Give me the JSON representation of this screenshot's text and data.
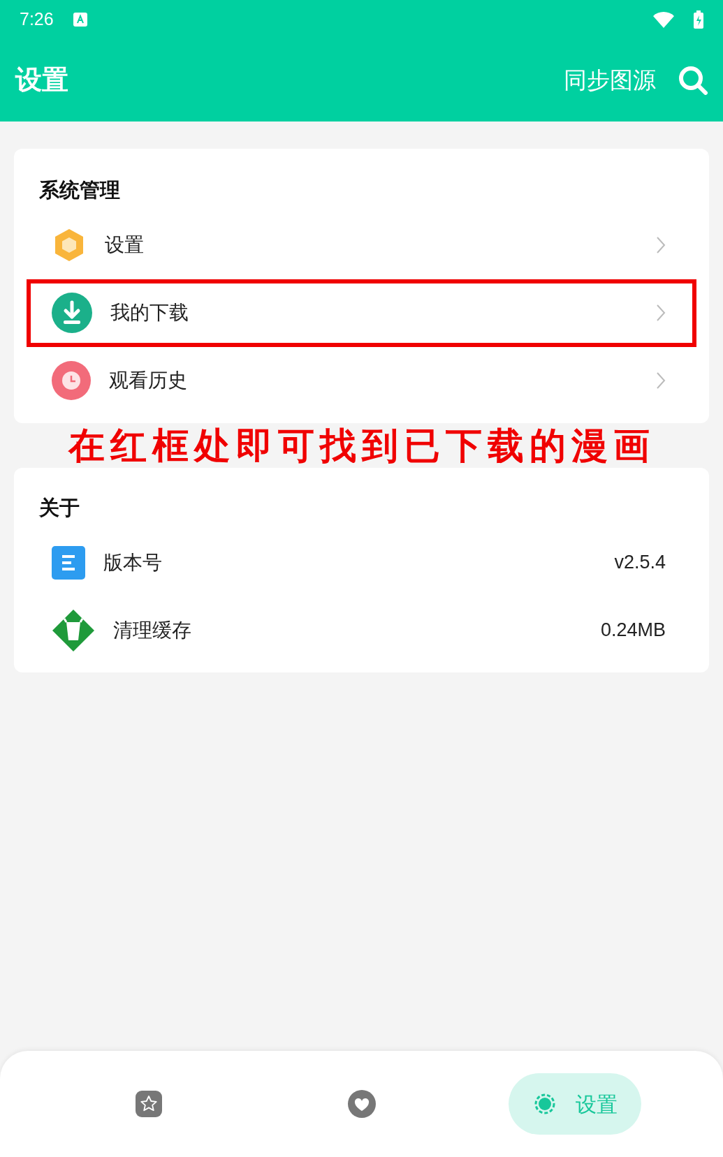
{
  "status_bar": {
    "time": "7:26"
  },
  "header": {
    "title": "设置",
    "action": "同步图源"
  },
  "sections": [
    {
      "title": "系统管理",
      "items": [
        {
          "kind": "hexagon",
          "label": "设置",
          "highlighted": false
        },
        {
          "kind": "download",
          "label": "我的下载",
          "highlighted": true
        },
        {
          "kind": "clock",
          "label": "观看历史",
          "highlighted": false
        }
      ]
    },
    {
      "title": "关于",
      "items": [
        {
          "kind": "document",
          "label": "版本号",
          "value": "v2.5.4",
          "highlighted": false
        },
        {
          "kind": "cup",
          "label": "清理缓存",
          "value": "0.24MB",
          "highlighted": false
        }
      ]
    }
  ],
  "annotation": "在红框处即可找到已下载的漫画",
  "bottom_nav": [
    {
      "kind": "star",
      "selected": false
    },
    {
      "kind": "heart",
      "selected": false
    },
    {
      "kind": "gear",
      "label": "设置",
      "selected": true
    }
  ]
}
